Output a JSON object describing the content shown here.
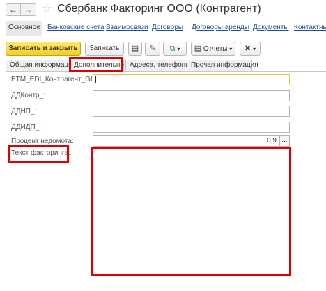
{
  "window": {
    "title": "Сбербанк Факторинг ООО (Контрагент)",
    "back_glyph": "←",
    "forward_glyph": "→",
    "star_glyph": "☆"
  },
  "nav_links": [
    "Основное",
    "Банковские счета",
    "Взаимосвязи",
    "Договоры",
    "Договоры аренды",
    "Документы",
    "Контактные"
  ],
  "toolbar": {
    "save_close_label": "Записать и закрыть",
    "save_label": "Записать",
    "reports_label": "Отчеты",
    "icon_doc": "▤",
    "icon_edit": "✎",
    "icon_copy": "⧉",
    "icon_tools": "✖",
    "dropdown_arrow": "▾"
  },
  "tabs": [
    "Общая информация",
    "Дополнительно",
    "Адреса, телефоны",
    "Прочая информация"
  ],
  "fields": {
    "etm_label": "ETM_EDI_Контрагент_GLN:",
    "etm_value": "",
    "ddkontr_label": "ДДКонтр_:",
    "ddkontr_value": "",
    "ddnp_label": "ДДНП_:",
    "ddnp_value": "",
    "ddidp_label": "ДДИДП_:",
    "ddidp_value": "",
    "percent_label": "Процент недомота:",
    "percent_value": "0,9",
    "percent_button": "...",
    "factoring_label": "Текст факторинга:",
    "factoring_value": ""
  },
  "colors": {
    "highlight": "#e00000",
    "primary_button": "#f2cf23",
    "link": "#1f4e9e"
  }
}
